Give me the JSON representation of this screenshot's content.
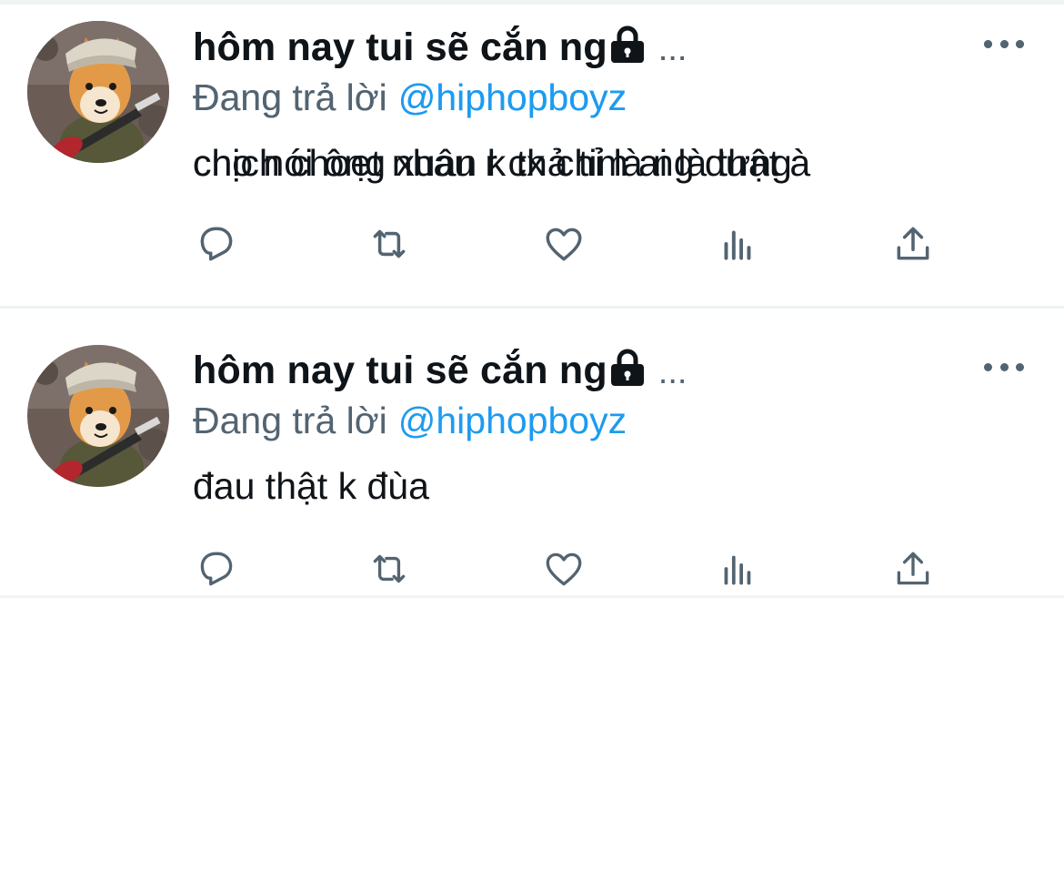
{
  "tweets": [
    {
      "display_name": "hôm nay tui sẽ cắn ng",
      "ellipsis": "...",
      "reply_prefix": "Đang trả lời",
      "reply_handle": "@hiphopboyz",
      "text": "đau thật k đùa"
    },
    {
      "display_name": "hôm nay tui sẽ cắn ng",
      "ellipsis": "...",
      "reply_prefix": "Đang trả lời",
      "reply_handle": "@hiphopboyz",
      "text": "chịch choẹt nhau r cx chỉ là ng dưng"
    },
    {
      "display_name": "hôm nay tui sẽ cắn ng",
      "ellipsis": "...",
      "reply_prefix": "Đang trả lời",
      "reply_handle": "@hiphopboyz",
      "text": "cno nói ông xuân k thả tim ai là thật à"
    }
  ],
  "icons": {
    "avatar": "shiba-dog-with-guitar-avatar",
    "lock": "lock-icon",
    "more": "more-horizontal-icon",
    "reply": "reply-icon",
    "retweet": "retweet-icon",
    "like": "heart-icon",
    "views": "views-bar-chart-icon",
    "share": "share-icon"
  },
  "colors": {
    "text_primary": "#0f1419",
    "text_secondary": "#536471",
    "link": "#1d9bf0",
    "divider": "#eff3f4",
    "icon": "#536471"
  }
}
